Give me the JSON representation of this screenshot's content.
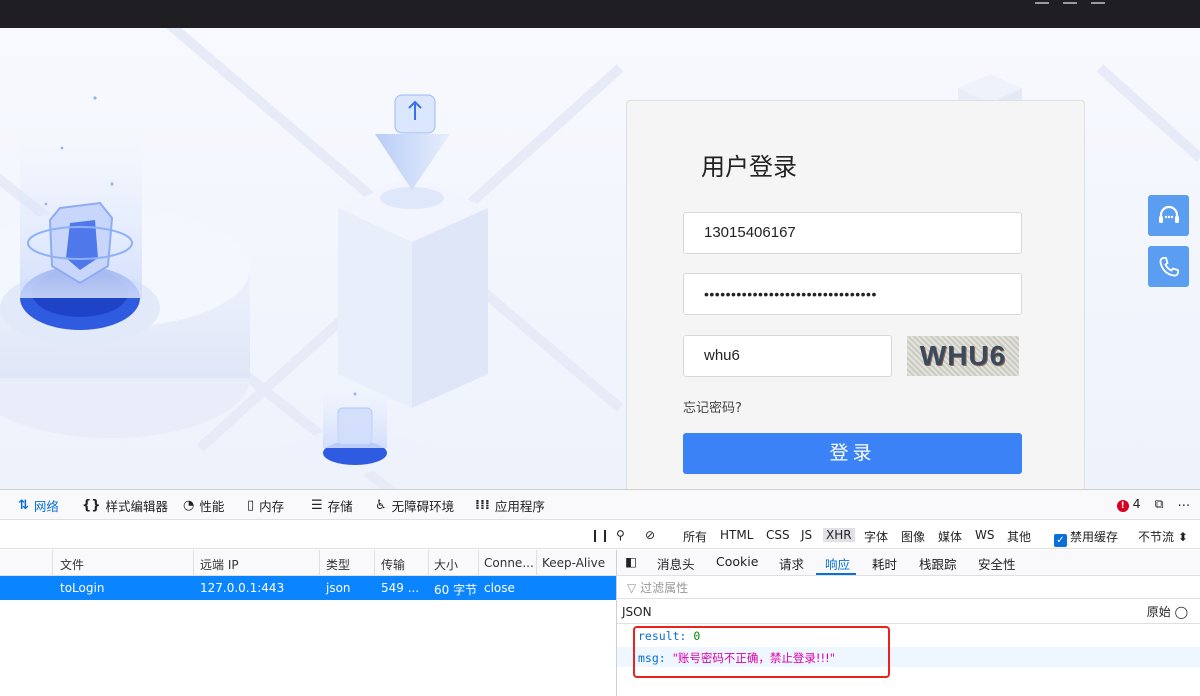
{
  "login": {
    "title": "用户登录",
    "phone_value": "13015406167",
    "password_mask": "••••••••••••••••••••••••••••••••",
    "captcha_value": "whu6",
    "captcha_image_text": "WHU6",
    "forgot_label": "忘记密码?",
    "submit_label": "登录"
  },
  "devtools": {
    "tabs": [
      "网络",
      "样式编辑器",
      "性能",
      "内存",
      "存储",
      "无障碍环境",
      "应用程序"
    ],
    "error_count": "4",
    "filters": [
      "所有",
      "HTML",
      "CSS",
      "JS",
      "XHR",
      "字体",
      "图像",
      "媒体",
      "WS",
      "其他"
    ],
    "disable_cache_label": "禁用缓存",
    "throttle_label": "不节流 ⬍",
    "columns": [
      "文件",
      "远端 IP",
      "类型",
      "传输",
      "大小",
      "Conne...",
      "Keep-Alive"
    ],
    "request": {
      "file": "toLogin",
      "remote_ip": "127.0.0.1:443",
      "type": "json",
      "transferred": "549 ...",
      "size": "60 字节",
      "connection": "close"
    },
    "detail_tabs": [
      "消息头",
      "Cookie",
      "请求",
      "响应",
      "耗时",
      "栈跟踪",
      "安全性"
    ],
    "filter_placeholder": "过滤属性",
    "json_label": "JSON",
    "raw_label": "原始",
    "response": {
      "result_key": "result:",
      "result_value": "0",
      "msg_key": "msg:",
      "msg_value": "\"账号密码不正确，禁止登录!!!\""
    }
  },
  "colors": {
    "accent": "#3b82f6",
    "selected_row": "#0a84ff",
    "highlight_box": "#e8231f"
  }
}
